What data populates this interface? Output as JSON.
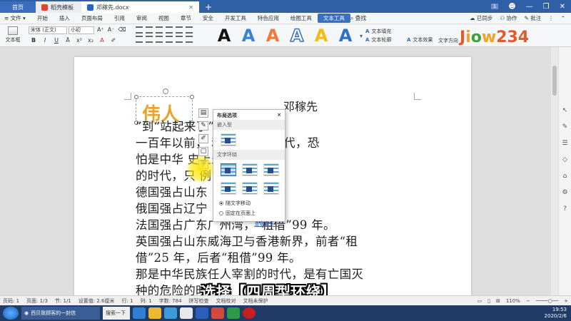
{
  "tabs": {
    "home": "首页",
    "template": "稻壳模板",
    "doc": "邓稼先.docx",
    "add": "+"
  },
  "window": {
    "badge": "1"
  },
  "menu": {
    "file": "文件",
    "items": [
      "开始",
      "插入",
      "页面布局",
      "引用",
      "审阅",
      "视图",
      "章节",
      "安全",
      "开发工具",
      "特色应用",
      "绘图工具",
      "文本工具"
    ],
    "search": "查找",
    "sync": "已同步",
    "collab": "协作",
    "comment": "批注"
  },
  "ribbon": {
    "style_label": "文本框",
    "font_name": "宋体 (正文)",
    "font_size": "小初",
    "bold": "B",
    "italic": "I",
    "underline": "U",
    "wordart_glyph": "A",
    "text_fill": "文本填充",
    "text_outline": "文本轮廓",
    "text_effect": "文本效果",
    "text_direction": "文字方向",
    "logo": "Jiow234"
  },
  "document": {
    "wordart": "伟人",
    "author": "邓稼先",
    "lines": [
      "                       ”到“站起来了”。",
      "一百年以前，         和八国联军时代，恐",
      "怕是中华          史上最黑暗最悲惨",
      "的时代，只         例：",
      "德国强占山东         “租借”99 年。",
      "俄国强占辽宁         “租借”25 年。",
      "法国强占广东广州湾，“租借”99 年。",
      "英国强占山东威海卫与香港新界，前者“租",
      "借”25 年，后者“租借”99 年。",
      "那是中华民族任人宰割的时代，是有亡国灭",
      "种的危险的时代。"
    ]
  },
  "float_tools": {
    "char_label": "字"
  },
  "popup": {
    "title": "布局选项",
    "close": "×",
    "section_inline": "嵌入型",
    "section_wrap": "文字环绕",
    "radio_move": "随文字移动",
    "radio_fixed": "固定在页面上",
    "see_more": "查看更多..."
  },
  "subtitle": "选择【四周型环绕】",
  "status": {
    "page": "页码: 1",
    "pages": "页面: 1/3",
    "section": "节: 1/1",
    "settings": "设置值: 2.6厘米",
    "line": "行: 1",
    "col": "列: 1",
    "words": "字数: 784",
    "spell": "拼写检查",
    "proof": "文档校对",
    "protect": "文档未保护",
    "zoom": "110%"
  },
  "taskbar": {
    "task1": "西贝致顾客的一封信",
    "search": "搜索一下",
    "time": "19:53",
    "date": "2020/2/6"
  },
  "colors": {
    "accent": "#2f5fa7",
    "wordart": "#e6a42b",
    "subtitle": "#ffffff",
    "glow": "#ffe600"
  }
}
